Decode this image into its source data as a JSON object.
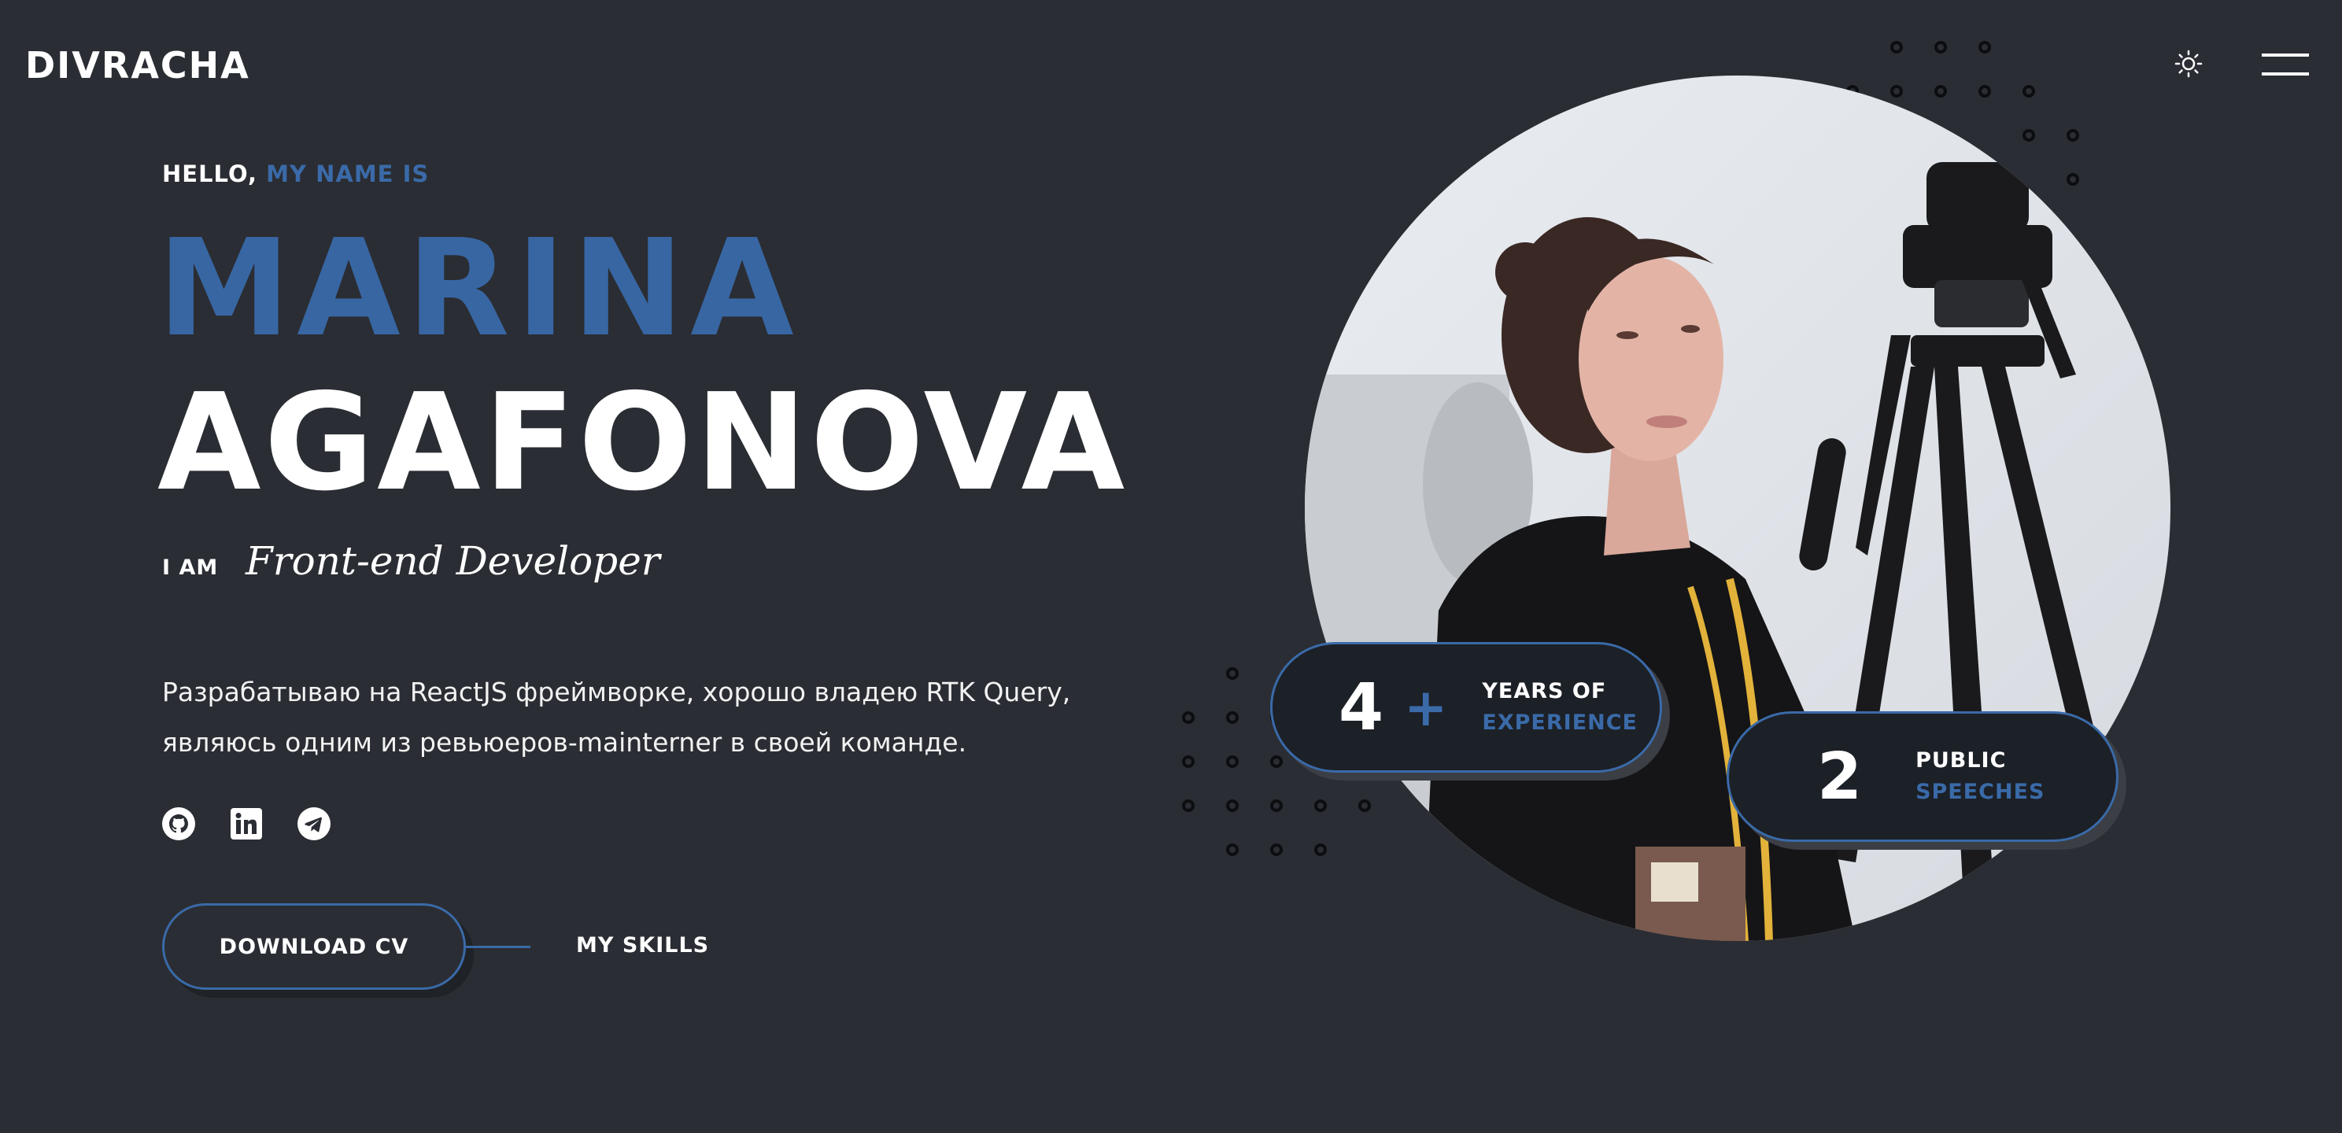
{
  "header": {
    "logo": "DIVRACHA",
    "theme_toggle_icon": "sun-icon",
    "menu_icon": "hamburger-menu-icon"
  },
  "hero": {
    "greeting_prefix": "HELLO,",
    "greeting_accent": "MY NAME IS",
    "first_name": "MARINA",
    "last_name": "AGAFONOVA",
    "i_am": "I AM",
    "role": "Front-end Developer",
    "description_line1": "Разрабатываю на ReactJS фреймворке, хорошо владею RTK Query,",
    "description_line2": "являюсь одним из ревьюеров-mainterner в своей команде.",
    "socials": [
      {
        "icon": "github-icon"
      },
      {
        "icon": "linkedin-icon"
      },
      {
        "icon": "telegram-icon"
      }
    ],
    "download_cv_label": "DOWNLOAD CV",
    "my_skills_label": "MY SKILLS"
  },
  "stats": {
    "experience": {
      "value": "4",
      "plus": "+",
      "label_line1": "YEARS OF",
      "label_line2": "EXPERIENCE"
    },
    "speeches": {
      "value": "2",
      "label_line1": "PUBLIC",
      "label_line2": "SPEECHES"
    }
  },
  "colors": {
    "background": "#2a2d33",
    "accent": "#3866a3",
    "badge_bg": "#1c2027",
    "text": "#ffffff"
  }
}
